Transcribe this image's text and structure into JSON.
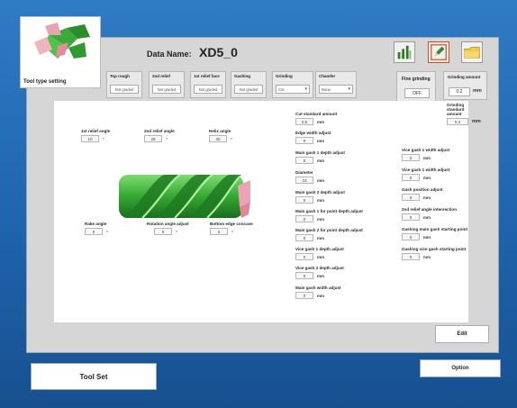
{
  "tool_card": {
    "label": "Tool type setting",
    "icon": "end-mill-tool-icon"
  },
  "header": {
    "data_name_label": "Data Name:",
    "data_name_value": "XD5_0"
  },
  "toolbar": [
    {
      "name": "chart-icon"
    },
    {
      "name": "pencil-edit-icon"
    },
    {
      "name": "folder-icon"
    }
  ],
  "columns": [
    {
      "title": "Top rough",
      "value": "Not graded"
    },
    {
      "title": "2nd relief",
      "value": "Not graded"
    },
    {
      "title": "1st relief face",
      "value": "Not graded"
    },
    {
      "title": "Gashing",
      "value": "Not graded"
    },
    {
      "title": "Grinding",
      "value": "Cut"
    },
    {
      "title": "Chamfer",
      "value": "None"
    }
  ],
  "fine_grinding": {
    "title": "Fine grinding",
    "value": "OFF"
  },
  "grinding_amount": {
    "title": "Grinding amount",
    "value": "0.2",
    "unit": "mm"
  },
  "grinding_standard": {
    "title": "Grinding standard amount",
    "value": "0.4",
    "unit": "mm"
  },
  "left_fields": [
    {
      "label": "1st relief angle",
      "value": "10",
      "unit": "°"
    },
    {
      "label": "2nd relief angle",
      "value": "25",
      "unit": "°"
    },
    {
      "label": "Helix angle",
      "value": "30",
      "unit": "°"
    },
    {
      "label": "Rake angle",
      "value": "0",
      "unit": "°"
    },
    {
      "label": "Rotation angle adjust",
      "value": "0",
      "unit": "°"
    },
    {
      "label": "Bottom edge concave",
      "value": "2",
      "unit": "°"
    }
  ],
  "mid_fields": [
    {
      "label": "Cut standard amount",
      "value": "0.5",
      "unit": "mm"
    },
    {
      "label": "Edge width adjust",
      "value": "0",
      "unit": "mm"
    },
    {
      "label": "Main gash 1 depth adjust",
      "value": "0",
      "unit": "mm"
    },
    {
      "label": "Diameter",
      "value": "10",
      "unit": "mm"
    },
    {
      "label": "Main gash 2 depth adjust",
      "value": "0",
      "unit": "mm"
    },
    {
      "label": "Main gash 1 for point depth adjust",
      "value": "0",
      "unit": "mm"
    },
    {
      "label": "Main gash 2 for point depth adjust",
      "value": "0",
      "unit": "mm"
    },
    {
      "label": "Vice gash 1 depth adjust",
      "value": "0",
      "unit": "mm"
    },
    {
      "label": "Vice gash 2 depth adjust",
      "value": "0",
      "unit": "mm"
    },
    {
      "label": "Main gash width adjust",
      "value": "0",
      "unit": "mm"
    }
  ],
  "right_fields": [
    {
      "label": "Vice gash 1 width adjust",
      "value": "0",
      "unit": "mm"
    },
    {
      "label": "Vice gash 1 width adjust",
      "value": "0",
      "unit": "mm"
    },
    {
      "label": "Gash position adjust",
      "value": "0",
      "unit": "mm"
    },
    {
      "label": "2nd relief angle intersection",
      "value": "0",
      "unit": "mm"
    },
    {
      "label": "Gashing main gash starting point",
      "value": "0",
      "unit": "mm"
    },
    {
      "label": "Gashing vice gash starting point",
      "value": "0",
      "unit": "mm"
    }
  ],
  "buttons": {
    "edit": "Edit",
    "tool_set": "Tool Set",
    "option": "Option"
  }
}
